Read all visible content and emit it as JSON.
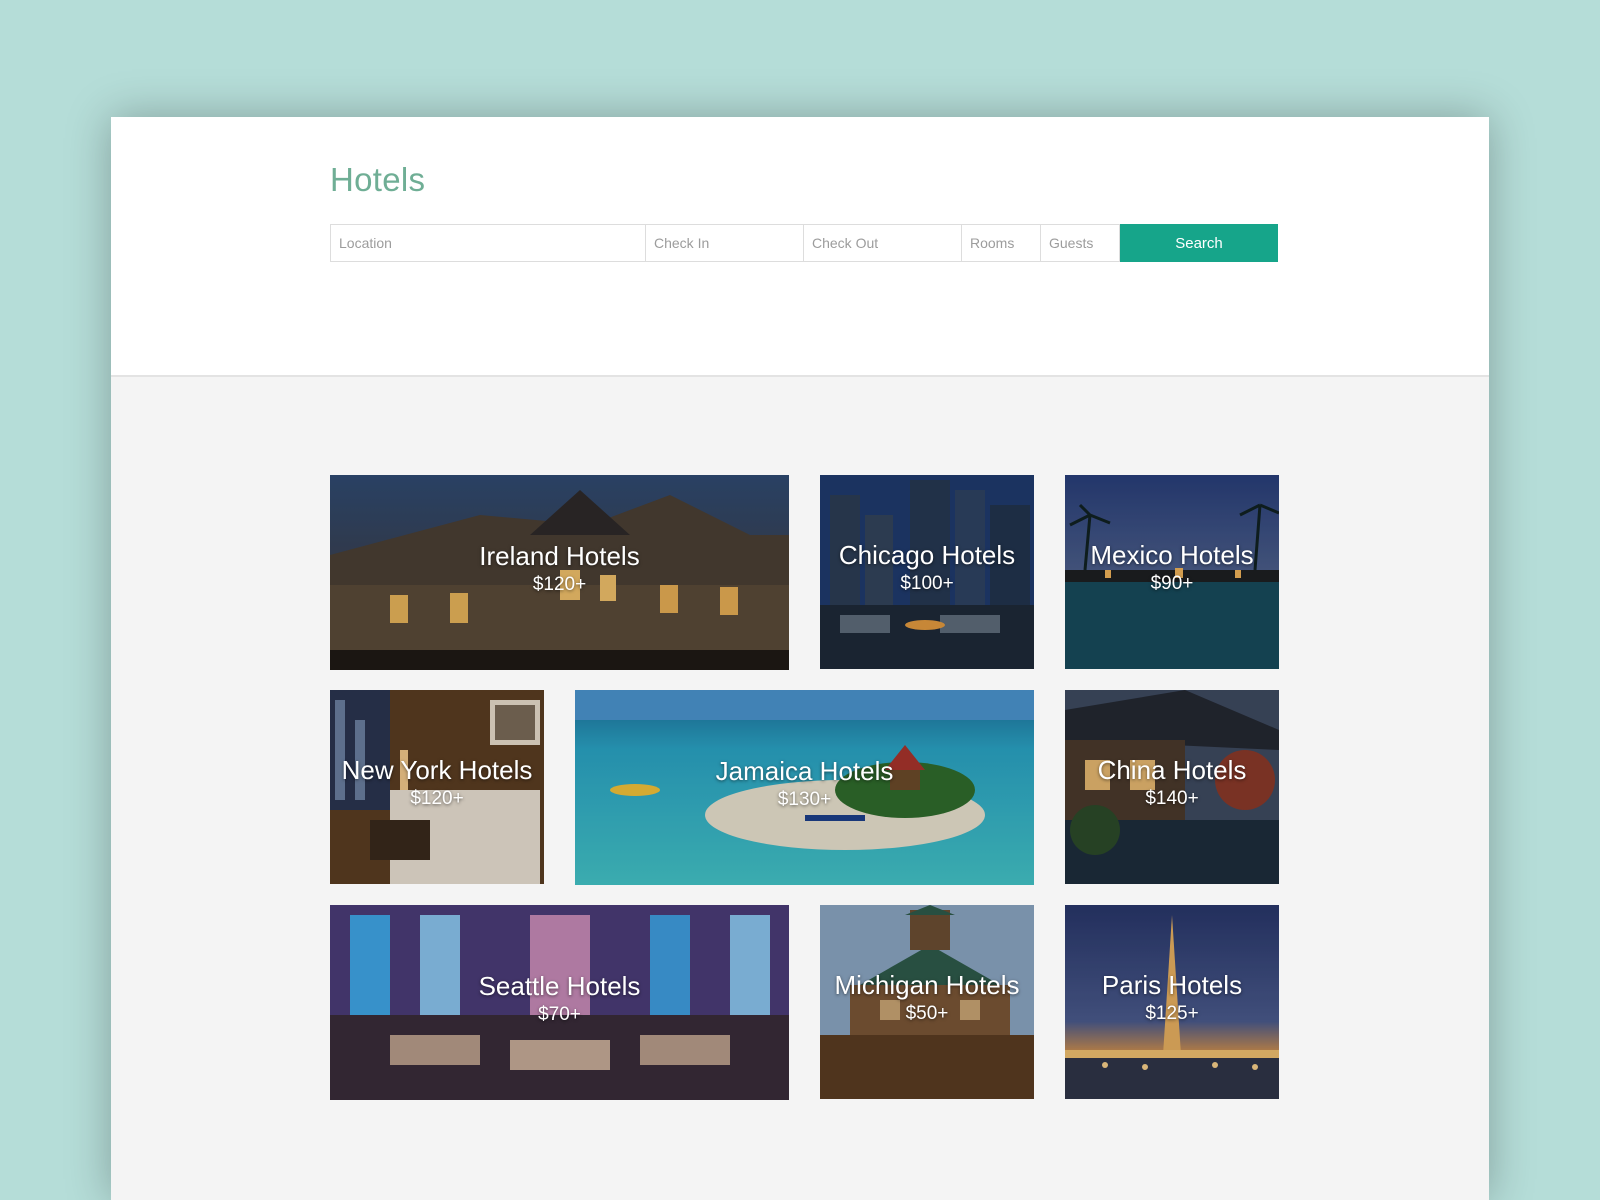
{
  "page": {
    "title": "Hotels"
  },
  "search": {
    "location_placeholder": "Location",
    "checkin_placeholder": "Check In",
    "checkout_placeholder": "Check Out",
    "rooms_placeholder": "Rooms",
    "guests_placeholder": "Guests",
    "button_label": "Search",
    "accent_color": "#16a58a"
  },
  "destinations": [
    {
      "name": "Ireland Hotels",
      "price": "$120+",
      "scene": "manor-at-dusk"
    },
    {
      "name": "Chicago Hotels",
      "price": "$100+",
      "scene": "skyline-terrace"
    },
    {
      "name": "Mexico Hotels",
      "price": "$90+",
      "scene": "palm-pool-dusk"
    },
    {
      "name": "New York Hotels",
      "price": "$120+",
      "scene": "hotel-bedroom"
    },
    {
      "name": "Jamaica Hotels",
      "price": "$130+",
      "scene": "tropical-island"
    },
    {
      "name": "China Hotels",
      "price": "$140+",
      "scene": "pagoda-by-water"
    },
    {
      "name": "Seattle Hotels",
      "price": "$70+",
      "scene": "lounge-blue-lights"
    },
    {
      "name": "Michigan Hotels",
      "price": "$50+",
      "scene": "log-lodge"
    },
    {
      "name": "Paris Hotels",
      "price": "$125+",
      "scene": "eiffel-tower-night"
    }
  ]
}
